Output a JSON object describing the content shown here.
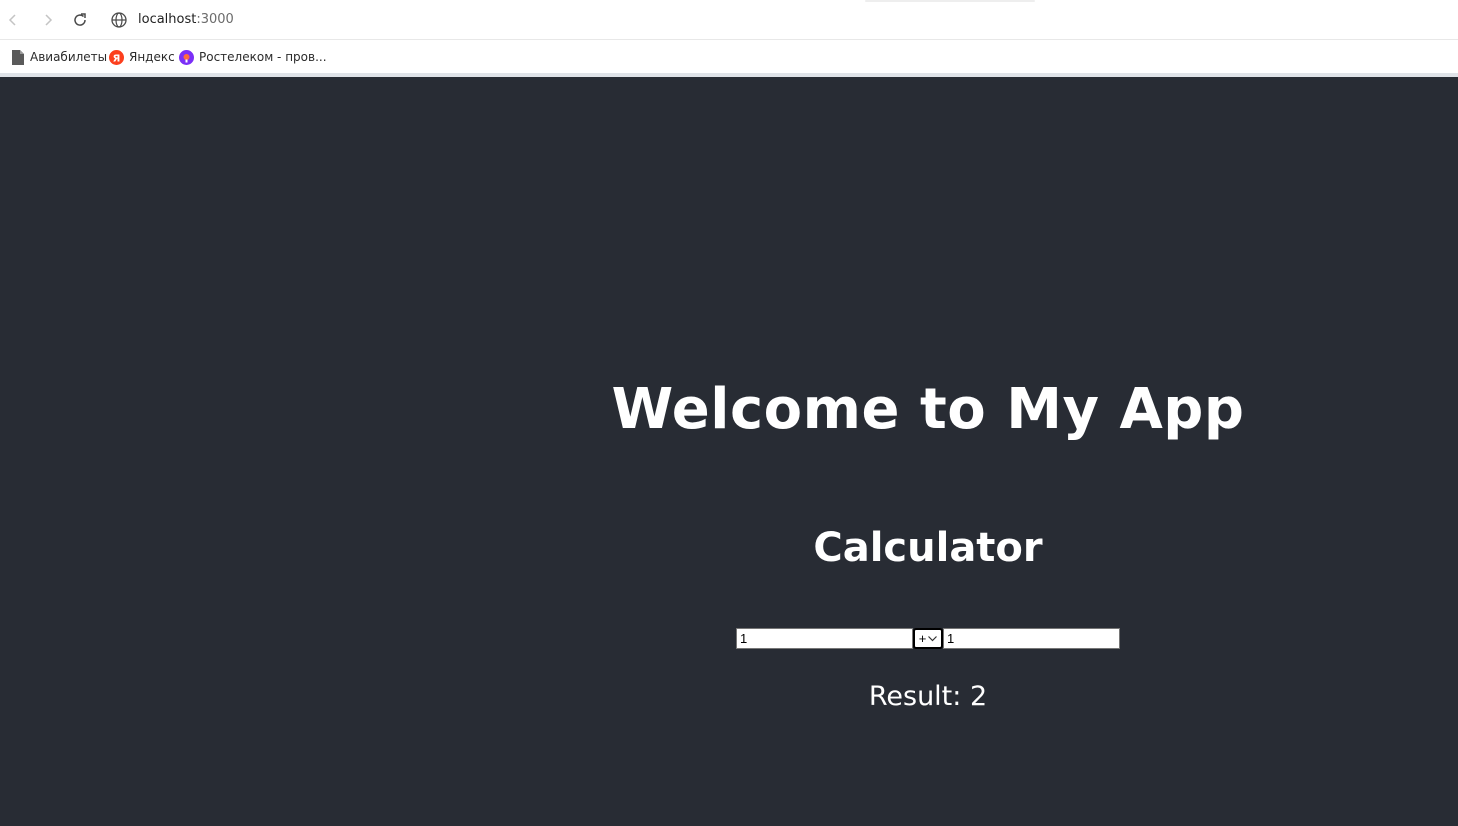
{
  "browser": {
    "address": {
      "host": "localhost",
      "port": ":3000"
    },
    "bookmarks": [
      {
        "label": "Авиабилеты",
        "icon": "page-icon"
      },
      {
        "label": "Яндекс",
        "icon": "yandex-icon",
        "icon_text": "Я",
        "color": "#fc3f1d"
      },
      {
        "label": "Ростелеком - пров...",
        "icon": "rostelecom-icon",
        "color": "#7b2ff7"
      }
    ]
  },
  "app": {
    "background": "#282c34",
    "heading": "Welcome to My App",
    "calculator": {
      "title": "Calculator",
      "operand_a": "1",
      "operator": "+",
      "operand_b": "1",
      "result_label": "Result: 2"
    }
  }
}
